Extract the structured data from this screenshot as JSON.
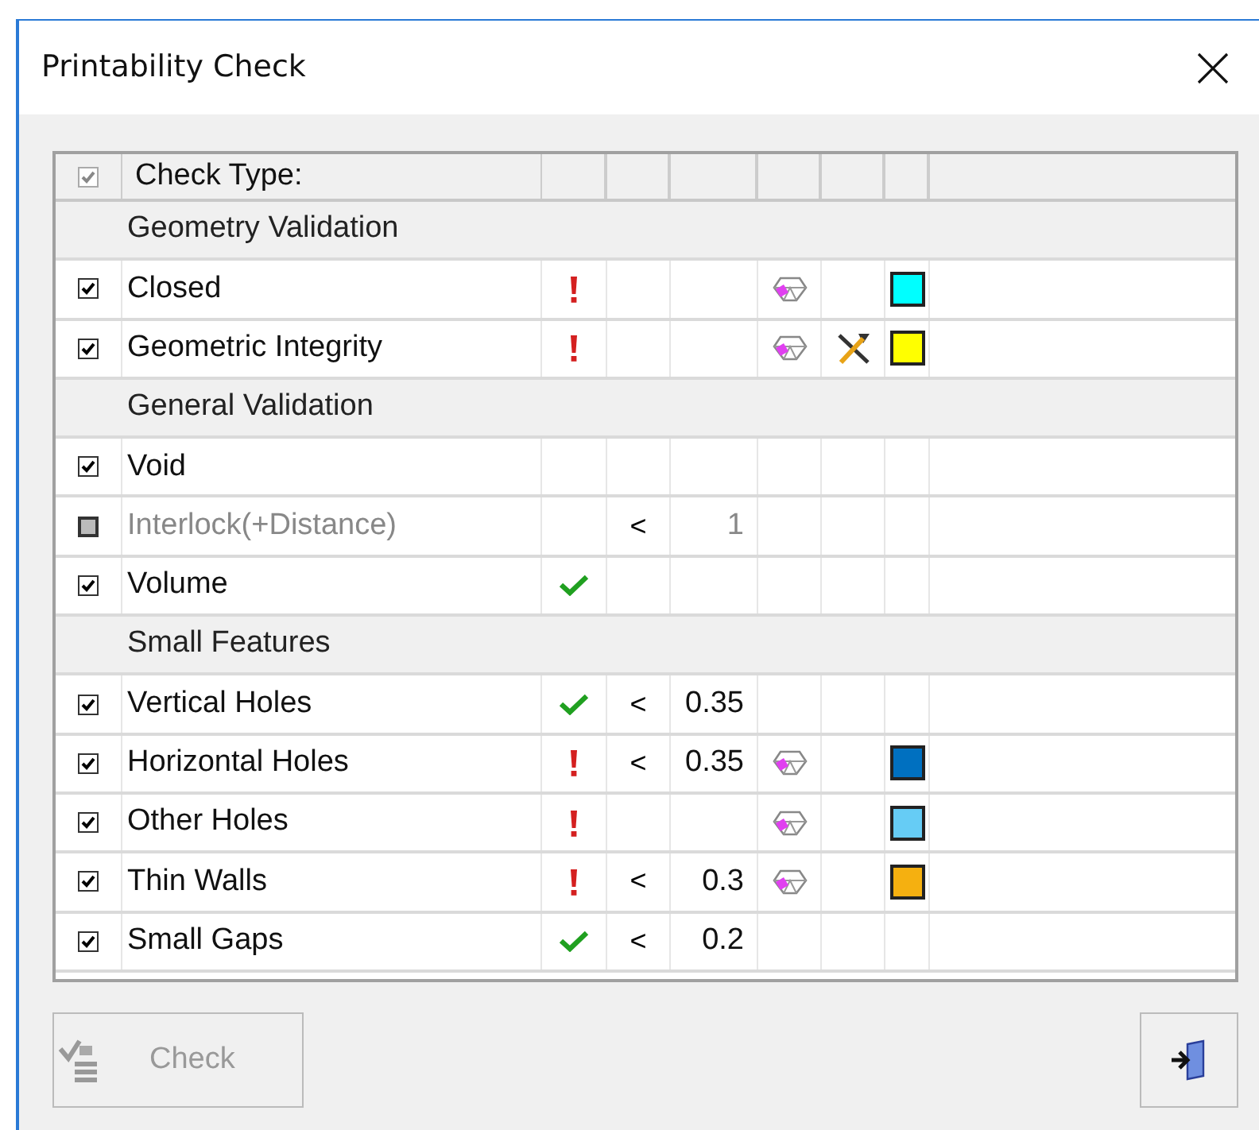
{
  "window": {
    "title": "Printability Check"
  },
  "table": {
    "header": {
      "label": "Check Type:",
      "checked": true,
      "disabled": true
    },
    "rows": [
      {
        "kind": "group",
        "label": "Geometry Validation"
      },
      {
        "kind": "item",
        "label": "Closed",
        "checked": true,
        "disabled": false,
        "passed": false,
        "preview": true,
        "repair": false,
        "color": "#00ffff"
      },
      {
        "kind": "item",
        "label": "Geometric Integrity",
        "checked": true,
        "disabled": false,
        "passed": false,
        "preview": true,
        "repair": true,
        "color": "#ffff00"
      },
      {
        "kind": "group",
        "label": "General Validation"
      },
      {
        "kind": "item",
        "label": "Void",
        "checked": true,
        "disabled": false,
        "preview": false,
        "repair": false
      },
      {
        "kind": "item",
        "label": "Interlock(+Distance)",
        "checked": false,
        "disabled": true,
        "operator": "<",
        "value": "1",
        "preview": false,
        "repair": false
      },
      {
        "kind": "item",
        "label": "Volume",
        "checked": true,
        "disabled": false,
        "passed": true,
        "preview": false,
        "repair": false
      },
      {
        "kind": "group",
        "label": "Small Features"
      },
      {
        "kind": "item",
        "label": "Vertical Holes",
        "checked": true,
        "disabled": false,
        "passed": true,
        "operator": "<",
        "value": "0.35",
        "preview": false,
        "repair": false
      },
      {
        "kind": "item",
        "label": "Horizontal Holes",
        "checked": true,
        "disabled": false,
        "passed": false,
        "operator": "<",
        "value": "0.35",
        "preview": true,
        "repair": false,
        "color": "#0070c0"
      },
      {
        "kind": "item",
        "label": "Other Holes",
        "checked": true,
        "disabled": false,
        "passed": false,
        "preview": true,
        "repair": false,
        "color": "#66ccf5"
      },
      {
        "kind": "item",
        "label": "Thin Walls",
        "checked": true,
        "disabled": false,
        "passed": false,
        "operator": "<",
        "value": "0.3",
        "preview": true,
        "repair": false,
        "color": "#f5b010"
      },
      {
        "kind": "item",
        "label": "Small Gaps",
        "checked": true,
        "disabled": false,
        "passed": true,
        "operator": "<",
        "value": "0.2",
        "preview": false,
        "repair": false
      }
    ]
  },
  "buttons": {
    "check": {
      "label": "Check",
      "disabled": true
    }
  }
}
